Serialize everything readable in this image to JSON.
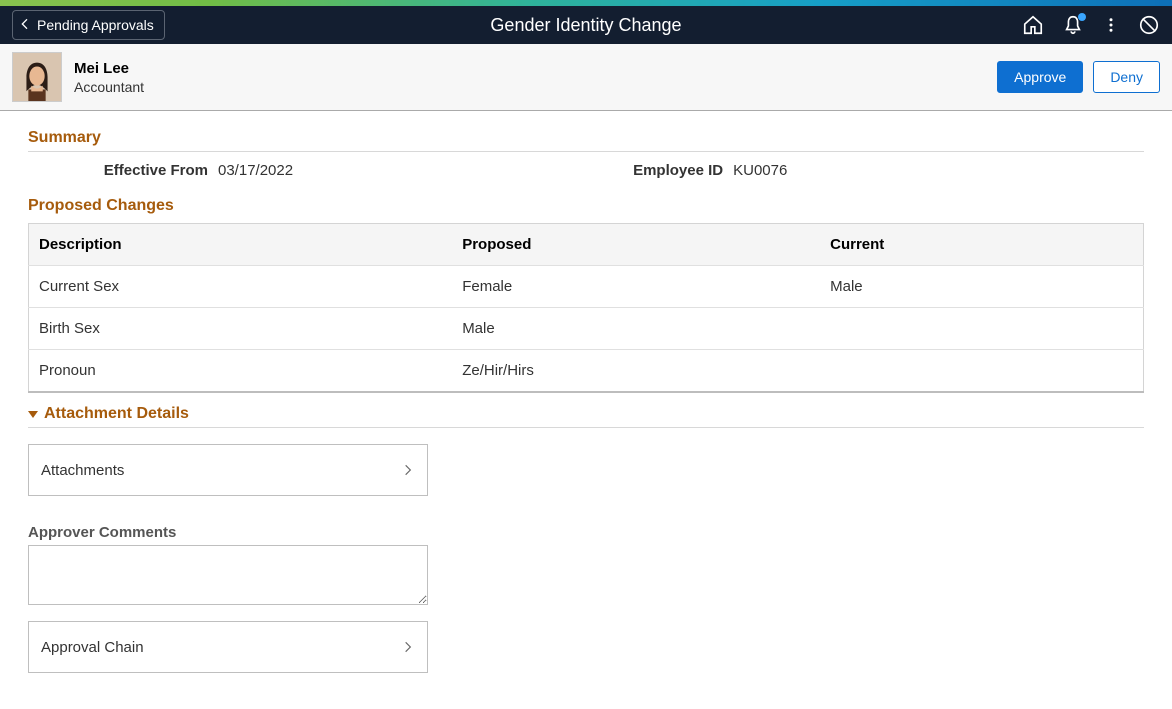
{
  "header": {
    "back_label": "Pending Approvals",
    "title": "Gender Identity Change"
  },
  "person": {
    "name": "Mei Lee",
    "role": "Accountant"
  },
  "actions": {
    "approve": "Approve",
    "deny": "Deny"
  },
  "summary": {
    "title": "Summary",
    "effective_from_label": "Effective From",
    "effective_from": "03/17/2022",
    "employee_id_label": "Employee ID",
    "employee_id": "KU0076"
  },
  "proposed": {
    "title": "Proposed Changes",
    "columns": {
      "description": "Description",
      "proposed": "Proposed",
      "current": "Current"
    },
    "rows": [
      {
        "description": "Current Sex",
        "proposed": "Female",
        "current": "Male"
      },
      {
        "description": "Birth Sex",
        "proposed": "Male",
        "current": ""
      },
      {
        "description": "Pronoun",
        "proposed": "Ze/Hir/Hirs",
        "current": ""
      }
    ]
  },
  "attachment": {
    "title": "Attachment Details",
    "row_label": "Attachments"
  },
  "comments": {
    "label": "Approver Comments",
    "value": ""
  },
  "approval_chain": {
    "label": "Approval Chain"
  }
}
